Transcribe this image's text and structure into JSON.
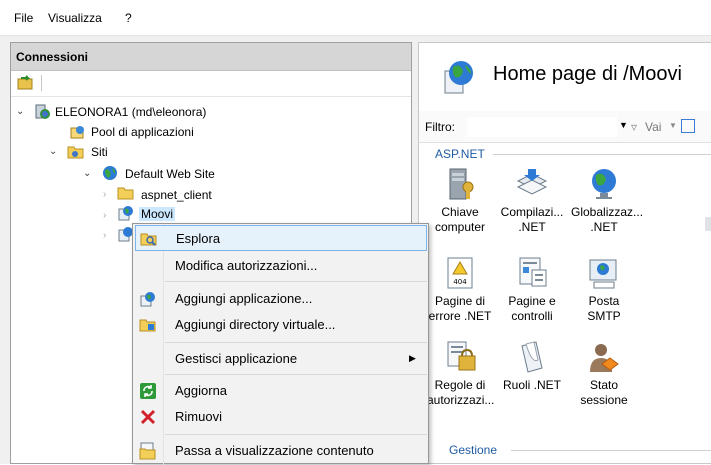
{
  "menubar": {
    "file": "File",
    "view": "Visualizza",
    "help": "?"
  },
  "connections": {
    "title": "Connessioni",
    "tree": {
      "server": "ELEONORA1 (md\\eleonora)",
      "app_pools": "Pool di applicazioni",
      "sites": "Siti",
      "default_site": "Default Web Site",
      "aspnet_client": "aspnet_client",
      "moovi": "Moovi"
    }
  },
  "home": {
    "title": "Home page di /Moovi",
    "filter_label": "Filtro:",
    "go_label": "Vai",
    "group_aspnet": "ASP.NET",
    "group_manage": "Gestione",
    "tiles": [
      {
        "l1": "Chiave",
        "l2": "computer"
      },
      {
        "l1": "Compilazi...",
        "l2": ".NET"
      },
      {
        "l1": "Globalizzaz...",
        "l2": ".NET"
      },
      {
        "l1": "Pagine di",
        "l2": "errore .NET"
      },
      {
        "l1": "Pagine e",
        "l2": "controlli"
      },
      {
        "l1": "Posta SMTP",
        "l2": ""
      },
      {
        "l1": "Regole di",
        "l2": "autorizzazi..."
      },
      {
        "l1": "Ruoli .NET",
        "l2": ""
      },
      {
        "l1": "Stato",
        "l2": "sessione"
      }
    ],
    "tile_404_text": "404"
  },
  "context_menu": {
    "explore": "Esplora",
    "edit_permissions": "Modifica autorizzazioni...",
    "add_application": "Aggiungi applicazione...",
    "add_virtual_dir": "Aggiungi directory virtuale...",
    "manage_application": "Gestisci applicazione",
    "refresh": "Aggiorna",
    "remove": "Rimuovi",
    "content_view": "Passa a visualizzazione contenuto"
  }
}
